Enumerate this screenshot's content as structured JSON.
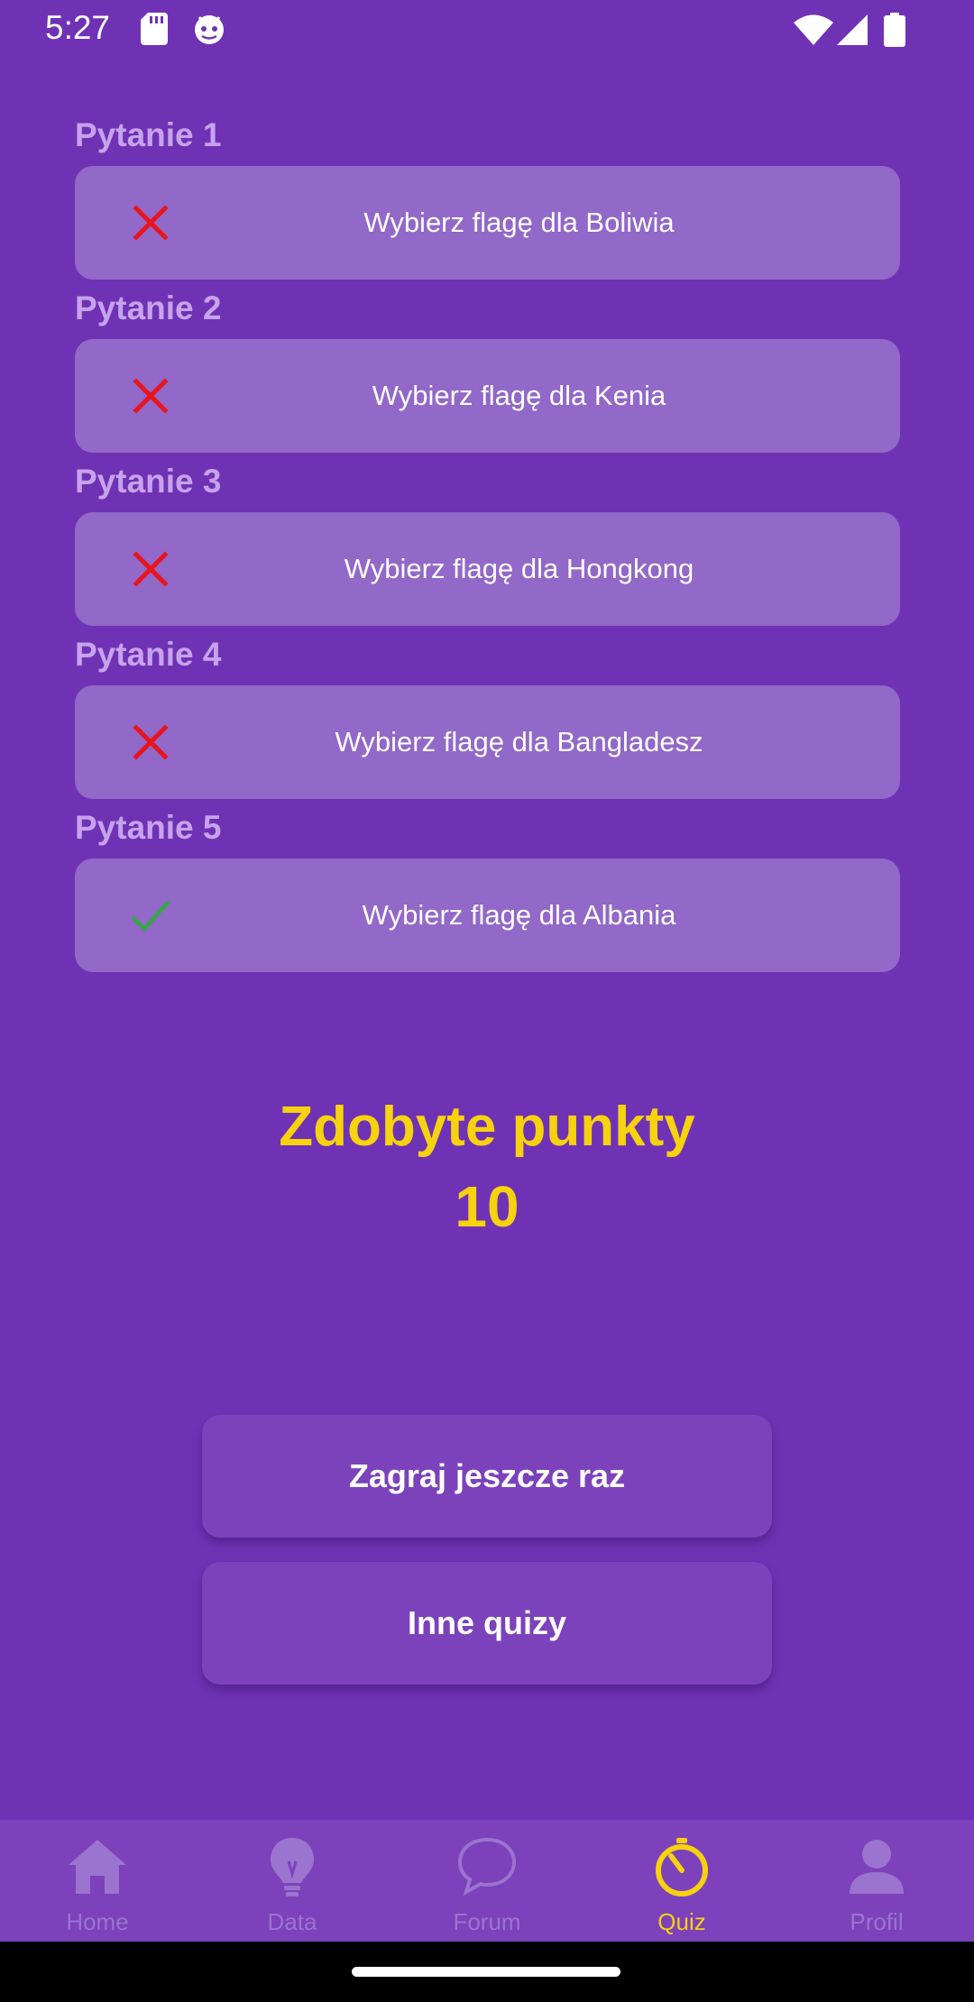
{
  "status_bar": {
    "time": "5:27",
    "icons_left": [
      "sd-card-icon",
      "android-debug-icon"
    ],
    "icons_right": [
      "wifi-icon",
      "signal-icon",
      "battery-icon"
    ]
  },
  "questions": [
    {
      "label": "Pytanie 1",
      "text": "Wybierz flagę dla Boliwia",
      "result": "incorrect"
    },
    {
      "label": "Pytanie 2",
      "text": "Wybierz flagę dla Kenia",
      "result": "incorrect"
    },
    {
      "label": "Pytanie 3",
      "text": "Wybierz flagę dla Hongkong",
      "result": "incorrect"
    },
    {
      "label": "Pytanie 4",
      "text": "Wybierz flagę dla Bangladesz",
      "result": "incorrect"
    },
    {
      "label": "Pytanie 5",
      "text": "Wybierz flagę dla Albania",
      "result": "correct"
    }
  ],
  "score": {
    "title": "Zdobyte punkty",
    "value": "10"
  },
  "actions": {
    "play_again": "Zagraj jeszcze raz",
    "other_quizzes": "Inne quizy"
  },
  "bottom_nav": {
    "items": [
      {
        "label": "Home",
        "icon": "home-icon",
        "active": false
      },
      {
        "label": "Data",
        "icon": "lightbulb-icon",
        "active": false
      },
      {
        "label": "Forum",
        "icon": "chat-icon",
        "active": false
      },
      {
        "label": "Quiz",
        "icon": "timer-icon",
        "active": true
      },
      {
        "label": "Profil",
        "icon": "person-icon",
        "active": false
      }
    ]
  },
  "colors": {
    "background": "#6f32b5",
    "card": "#9268c8",
    "accent": "#f6d20f",
    "incorrect": "#e8141e",
    "correct": "#2fae3a",
    "nav_inactive": "#9a74cf"
  }
}
